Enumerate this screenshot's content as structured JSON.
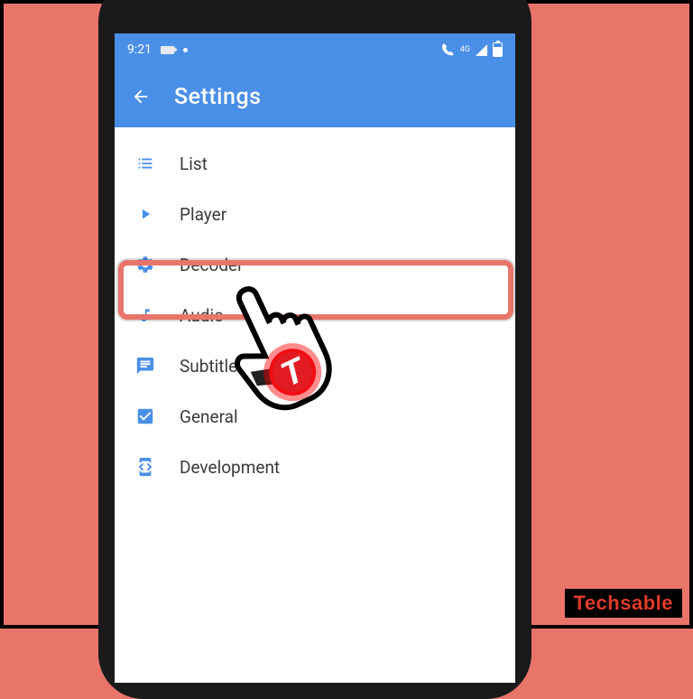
{
  "status": {
    "time": "9:21",
    "network_label": "4G"
  },
  "appbar": {
    "title": "Settings"
  },
  "settings": {
    "items": [
      {
        "label": "List"
      },
      {
        "label": "Player"
      },
      {
        "label": "Decoder"
      },
      {
        "label": "Audio"
      },
      {
        "label": "Subtitle"
      },
      {
        "label": "General"
      },
      {
        "label": "Development"
      }
    ]
  },
  "watermark": {
    "text": "Techsable"
  },
  "colors": {
    "accent": "#4a8fe7",
    "background": "#e8746a",
    "highlight": "#e8746a"
  }
}
